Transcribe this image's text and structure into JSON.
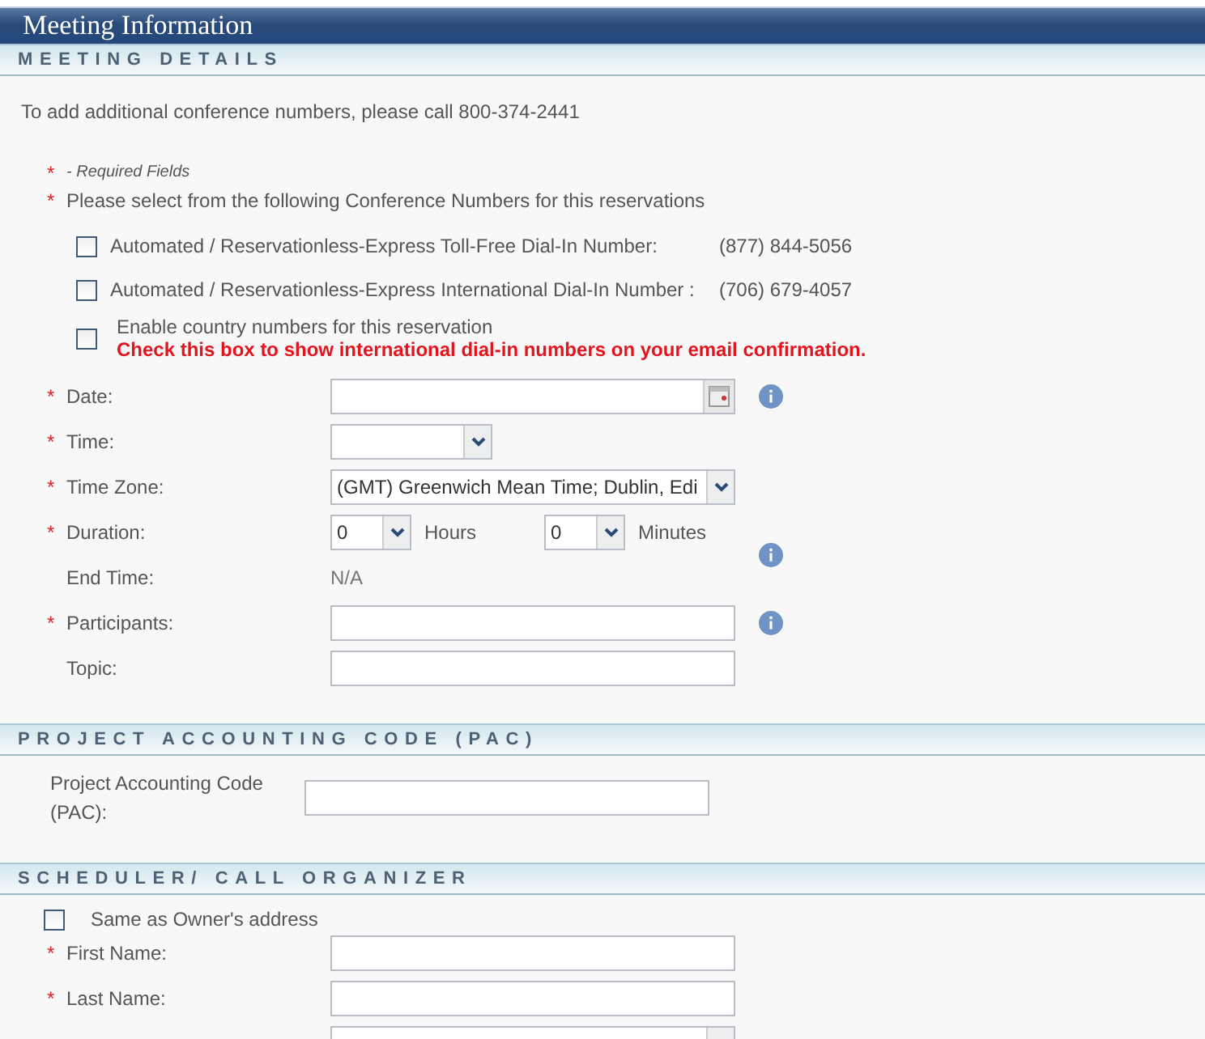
{
  "window": {
    "title": "Meeting Information"
  },
  "meeting_details": {
    "heading": "MEETING DETAILS",
    "note": "To add additional conference numbers, please call 800-374-2441",
    "required_legend": {
      "mark": "*",
      "text": "- Required Fields"
    },
    "select_prompt": {
      "mark": "*",
      "text": "Please select from the following Conference Numbers for this reservations"
    },
    "numbers": [
      {
        "label": "Automated / Reservationless-Express Toll-Free Dial-In Number:",
        "number": "(877) 844-5056",
        "checked": false
      },
      {
        "label": "Automated / Reservationless-Express International Dial-In Number :",
        "number": "(706) 679-4057",
        "checked": false
      }
    ],
    "country_option": {
      "label": "Enable country numbers for this reservation",
      "hint": "Check this box to show international dial-in numbers on your email confirmation.",
      "checked": false
    },
    "fields": [
      {
        "kind": "date",
        "mark": "*",
        "label": "Date:",
        "info": true
      },
      {
        "kind": "short_select",
        "mark": "*",
        "label": "Time:"
      },
      {
        "kind": "select",
        "mark": "*",
        "label": "Time Zone:",
        "value": "(GMT) Greenwich Mean Time; Dublin, Edi"
      },
      {
        "kind": "duration",
        "mark": "*",
        "label": "Duration:",
        "hours": "0",
        "hours_unit": "Hours",
        "minutes": "0",
        "minutes_unit": "Minutes",
        "info": true
      },
      {
        "kind": "static",
        "label": "End Time:",
        "value": "N/A"
      },
      {
        "kind": "text",
        "mark": "*",
        "label": "Participants:",
        "info": true
      },
      {
        "kind": "text",
        "label": "Topic:"
      }
    ]
  },
  "pac": {
    "heading": "PROJECT ACCOUNTING CODE (PAC)",
    "label": "Project Accounting Code (PAC):"
  },
  "scheduler": {
    "heading": "SCHEDULER/ CALL ORGANIZER",
    "same_as_owner": {
      "label": "Same as Owner's address",
      "checked": false
    },
    "fields": [
      {
        "kind": "text",
        "mark": "*",
        "label": "First Name:"
      },
      {
        "kind": "text",
        "mark": "*",
        "label": "Last Name:"
      },
      {
        "kind": "select"
      }
    ]
  }
}
